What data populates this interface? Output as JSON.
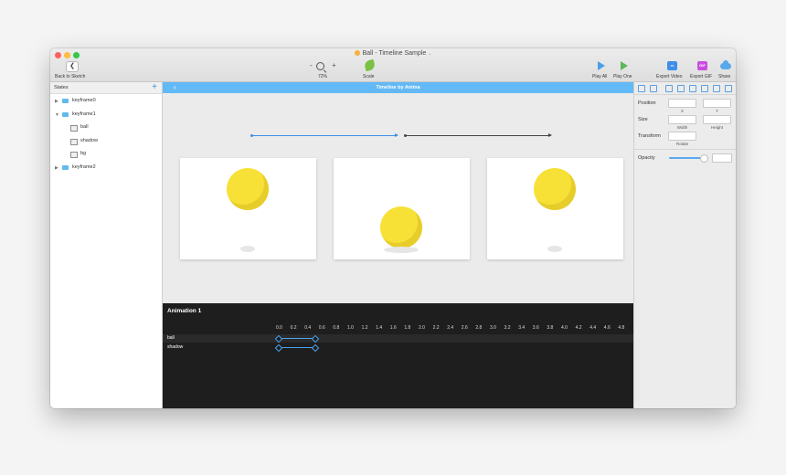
{
  "window": {
    "title": "Ball - Timeline Sample",
    "caret": "⌄"
  },
  "toolbar": {
    "back_glyph": "❮",
    "back_label": "Back to Sketch",
    "zoom_minus": "-",
    "zoom_plus": "+",
    "zoom_value": "72%",
    "scale_label": "Scale",
    "play_all_label": "Play All",
    "play_one_label": "Play One",
    "export_video_label": "Export Video",
    "export_gif_label": "Export GIF",
    "export_gif_badge": "GIF",
    "share_label": "Share"
  },
  "states_panel": {
    "header": "States",
    "add_glyph": "+",
    "items": [
      {
        "label": "keyframe0",
        "arrow": "▶"
      },
      {
        "label": "keyframe1",
        "arrow": "▼"
      },
      {
        "label": "ball"
      },
      {
        "label": "shadow"
      },
      {
        "label": "bg"
      },
      {
        "label": "keyframe2",
        "arrow": "▶"
      }
    ]
  },
  "canvas": {
    "header_back": "‹",
    "header_title": "Timeline by Anima"
  },
  "timeline": {
    "title": "Animation 1",
    "ticks": [
      "0.0",
      "0.2",
      "0.4",
      "0.6",
      "0.8",
      "1.0",
      "1.2",
      "1.4",
      "1.6",
      "1.8",
      "2.0",
      "2.2",
      "2.4",
      "2.6",
      "2.8",
      "3.0",
      "3.2",
      "3.4",
      "3.6",
      "3.8",
      "4.0",
      "4.2",
      "4.4",
      "4.6",
      "4.8"
    ],
    "tracks": [
      {
        "name": "ball",
        "start": 0.0,
        "end": 0.5
      },
      {
        "name": "shadow",
        "start": 0.0,
        "end": 0.5
      }
    ]
  },
  "inspector": {
    "position_label": "Position",
    "x_label": "X",
    "y_label": "Y",
    "size_label": "Size",
    "width_label": "Width",
    "height_label": "Height",
    "transform_label": "Transform",
    "rotate_label": "Rotate",
    "opacity_label": "Opacity",
    "opacity_value": 0.9
  },
  "colors": {
    "accent": "#62b9f6",
    "ball": "#f7e136",
    "timeline_bg": "#1e1e1e"
  }
}
